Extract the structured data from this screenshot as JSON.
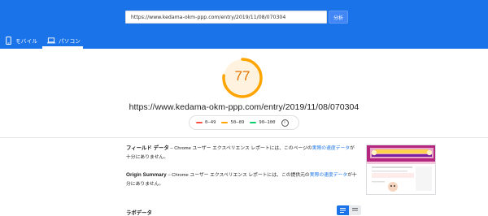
{
  "header": {
    "url_value": "https://www.kedama-okm-ppp.com/entry/2019/11/08/070304",
    "analyze_label": "分析",
    "tabs": [
      {
        "label": "モバイル",
        "icon": "smartphone-icon"
      },
      {
        "label": "パソコン",
        "icon": "laptop-icon",
        "active": true
      }
    ]
  },
  "score": {
    "value": "77",
    "fraction": 0.77,
    "color": "#ffa400",
    "text_color": "#e37400"
  },
  "page_url": "https://www.kedama-okm-ppp.com/entry/2019/11/08/070304",
  "legend": {
    "items": [
      {
        "label": "0–49",
        "color": "#ff4e42"
      },
      {
        "label": "50–89",
        "color": "#ffa400"
      },
      {
        "label": "90–100",
        "color": "#0cce6b"
      }
    ],
    "info_glyph": "i"
  },
  "field_data": {
    "title": "フィールド データ",
    "text": " – Chrome ユーザー エクスペリエンス レポートには、このページの",
    "link": "実際の速度データ",
    "text_after": "が十分にありません。"
  },
  "origin_summary": {
    "title": "Origin Summary",
    "text": " – Chrome ユーザー エクスペリエンス レポートには、この提供元の",
    "link": "実際の速度データ",
    "text_after": "が十分にありません。"
  },
  "lab_data": {
    "title": "ラボデータ"
  }
}
